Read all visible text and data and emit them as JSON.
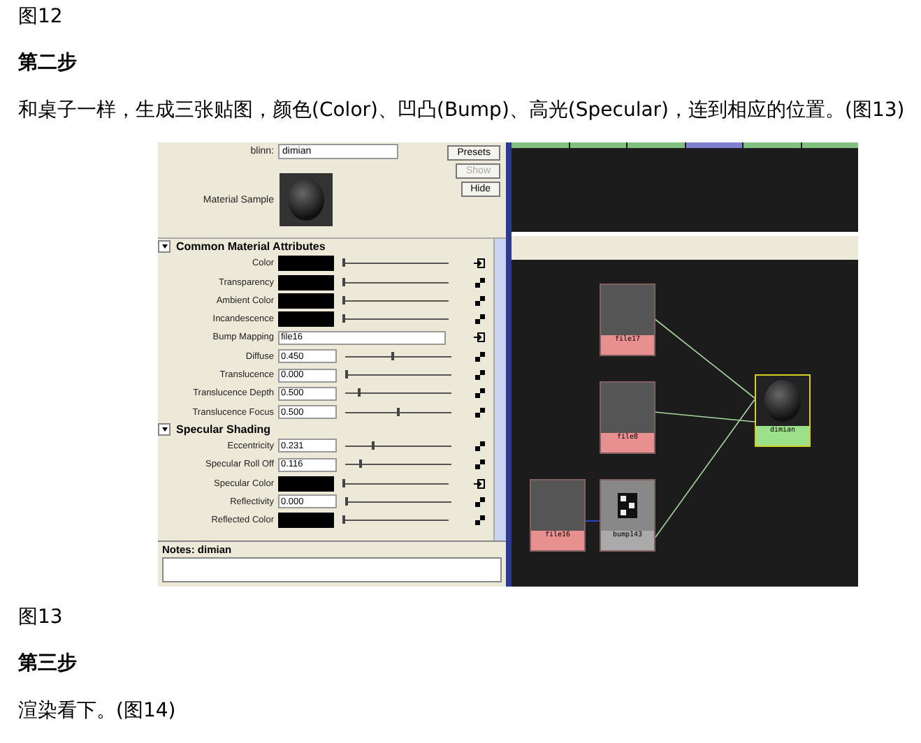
{
  "article": {
    "caption_top": "图12",
    "step_heading": "第二步",
    "paragraph": "和桌子一样，生成三张贴图，颜色(Color)、凹凸(Bump)、高光(Specular)，连到相应的位置。(图13)",
    "caption_bottom": "图13",
    "next_heading": "第三步",
    "next_paragraph": "渲染看下。(图14)"
  },
  "attribute_editor": {
    "type_label": "blinn:",
    "name_value": "dimian",
    "buttons": [
      {
        "label": "Presets",
        "disabled": false
      },
      {
        "label": "Show",
        "disabled": true
      },
      {
        "label": "Hide",
        "disabled": false
      }
    ],
    "sample_label": "Material Sample",
    "sections": [
      {
        "title": "Common Material Attributes",
        "expanded": true,
        "rows": [
          {
            "label": "Color",
            "kind": "color",
            "level": 0.0,
            "connected": true
          },
          {
            "label": "Transparency",
            "kind": "color",
            "level": 0.0,
            "connected": false
          },
          {
            "label": "Ambient Color",
            "kind": "color",
            "level": 0.0,
            "connected": false
          },
          {
            "label": "Incandescence",
            "kind": "color",
            "level": 0.0,
            "connected": false
          },
          {
            "label": "Bump Mapping",
            "kind": "text",
            "value": "file16",
            "connected": true
          },
          {
            "label": "Diffuse",
            "kind": "number",
            "value": "0.450",
            "level": 0.45,
            "connected": false
          },
          {
            "label": "Translucence",
            "kind": "number",
            "value": "0.000",
            "level": 0.0,
            "connected": false
          },
          {
            "label": "Translucence Depth",
            "kind": "number",
            "value": "0.500",
            "level": 0.12,
            "connected": false
          },
          {
            "label": "Translucence Focus",
            "kind": "number",
            "value": "0.500",
            "level": 0.5,
            "connected": false
          }
        ]
      },
      {
        "title": "Specular Shading",
        "expanded": true,
        "rows": [
          {
            "label": "Eccentricity",
            "kind": "number",
            "value": "0.231",
            "level": 0.25,
            "connected": false
          },
          {
            "label": "Specular Roll Off",
            "kind": "number",
            "value": "0.116",
            "level": 0.13,
            "connected": false
          },
          {
            "label": "Specular Color",
            "kind": "color",
            "level": 0.0,
            "connected": true
          },
          {
            "label": "Reflectivity",
            "kind": "number",
            "value": "0.000",
            "level": 0.0,
            "connected": false
          },
          {
            "label": "Reflected Color",
            "kind": "color",
            "level": 0.0,
            "connected": false
          }
        ]
      }
    ],
    "notes_label": "Notes:  dimian"
  },
  "hypershade": {
    "tabs": [
      {
        "selected": false
      },
      {
        "selected": false
      },
      {
        "selected": false
      },
      {
        "selected": true
      },
      {
        "selected": false
      },
      {
        "selected": false
      }
    ],
    "nodes": [
      {
        "label": "file17",
        "kind": "file",
        "selected": false
      },
      {
        "label": "file8",
        "kind": "file",
        "selected": false
      },
      {
        "label": "file16",
        "kind": "file",
        "selected": false
      },
      {
        "label": "bump143",
        "kind": "bump",
        "selected": false
      },
      {
        "label": "dimian",
        "kind": "shader",
        "selected": true
      }
    ]
  }
}
